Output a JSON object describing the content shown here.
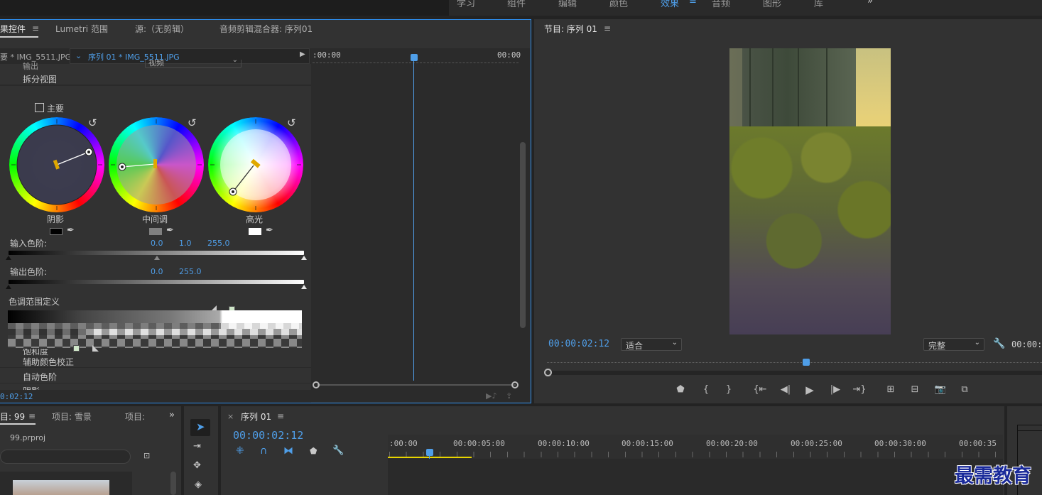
{
  "workspace_tabs": [
    "学习",
    "组件",
    "编辑",
    "颜色",
    "效果",
    "音频",
    "图形",
    "库"
  ],
  "workspace_active": "效果",
  "workspace_more": "»",
  "menu_glyph": "≡",
  "left_panel": {
    "tabs": [
      "果控件",
      "Lumetri 范围",
      "源:（无剪辑）",
      "音频剪辑混合器: 序列01"
    ],
    "subtab_left": "要 * IMG_5511.JPG",
    "subtab_active": "序列 01 * IMG_5511.JPG",
    "time_start": ":00:00",
    "time_end": "00:00",
    "output_label": "输出",
    "output_value": "视频",
    "split_view": "拆分视图",
    "master_checkbox": "主要",
    "wheels": [
      {
        "label": "阴影",
        "swatch": "#000000"
      },
      {
        "label": "中间调",
        "swatch": "#808080"
      },
      {
        "label": "高光",
        "swatch": "#ffffff"
      }
    ],
    "input_levels_label": "输入色阶:",
    "input_levels_values": [
      "0.0",
      "1.0",
      "255.0"
    ],
    "output_levels_label": "输出色阶:",
    "output_levels_values": [
      "0.0",
      "255.0"
    ],
    "tonal_range_label": "色调范围定义",
    "partial_row": "饱和度",
    "secondary_color": "辅助颜色校正",
    "auto_color": "自动色阶",
    "shadows_row": "阴影",
    "bottom_timecode": "0:02:12"
  },
  "program_monitor": {
    "title": "节目: 序列 01",
    "timecode": "00:00:02:12",
    "fit_label": "适合",
    "quality_label": "完整",
    "end_timecode": "00:00:"
  },
  "project_panel": {
    "tabs": [
      "目: 99",
      "项目: 雪景",
      "项目: 静"
    ],
    "file": "99.prproj"
  },
  "timeline": {
    "title": "序列 01",
    "timecode": "00:00:02:12",
    "ruler": [
      ":00:00",
      "00:00:05:00",
      "00:00:10:00",
      "00:00:15:00",
      "00:00:20:00",
      "00:00:25:00",
      "00:00:30:00",
      "00:00:35"
    ]
  },
  "watermark": "最需教育",
  "colors": {
    "accent": "#2d8ceb",
    "playhead": "#4f9ee8",
    "panel": "#323232"
  }
}
